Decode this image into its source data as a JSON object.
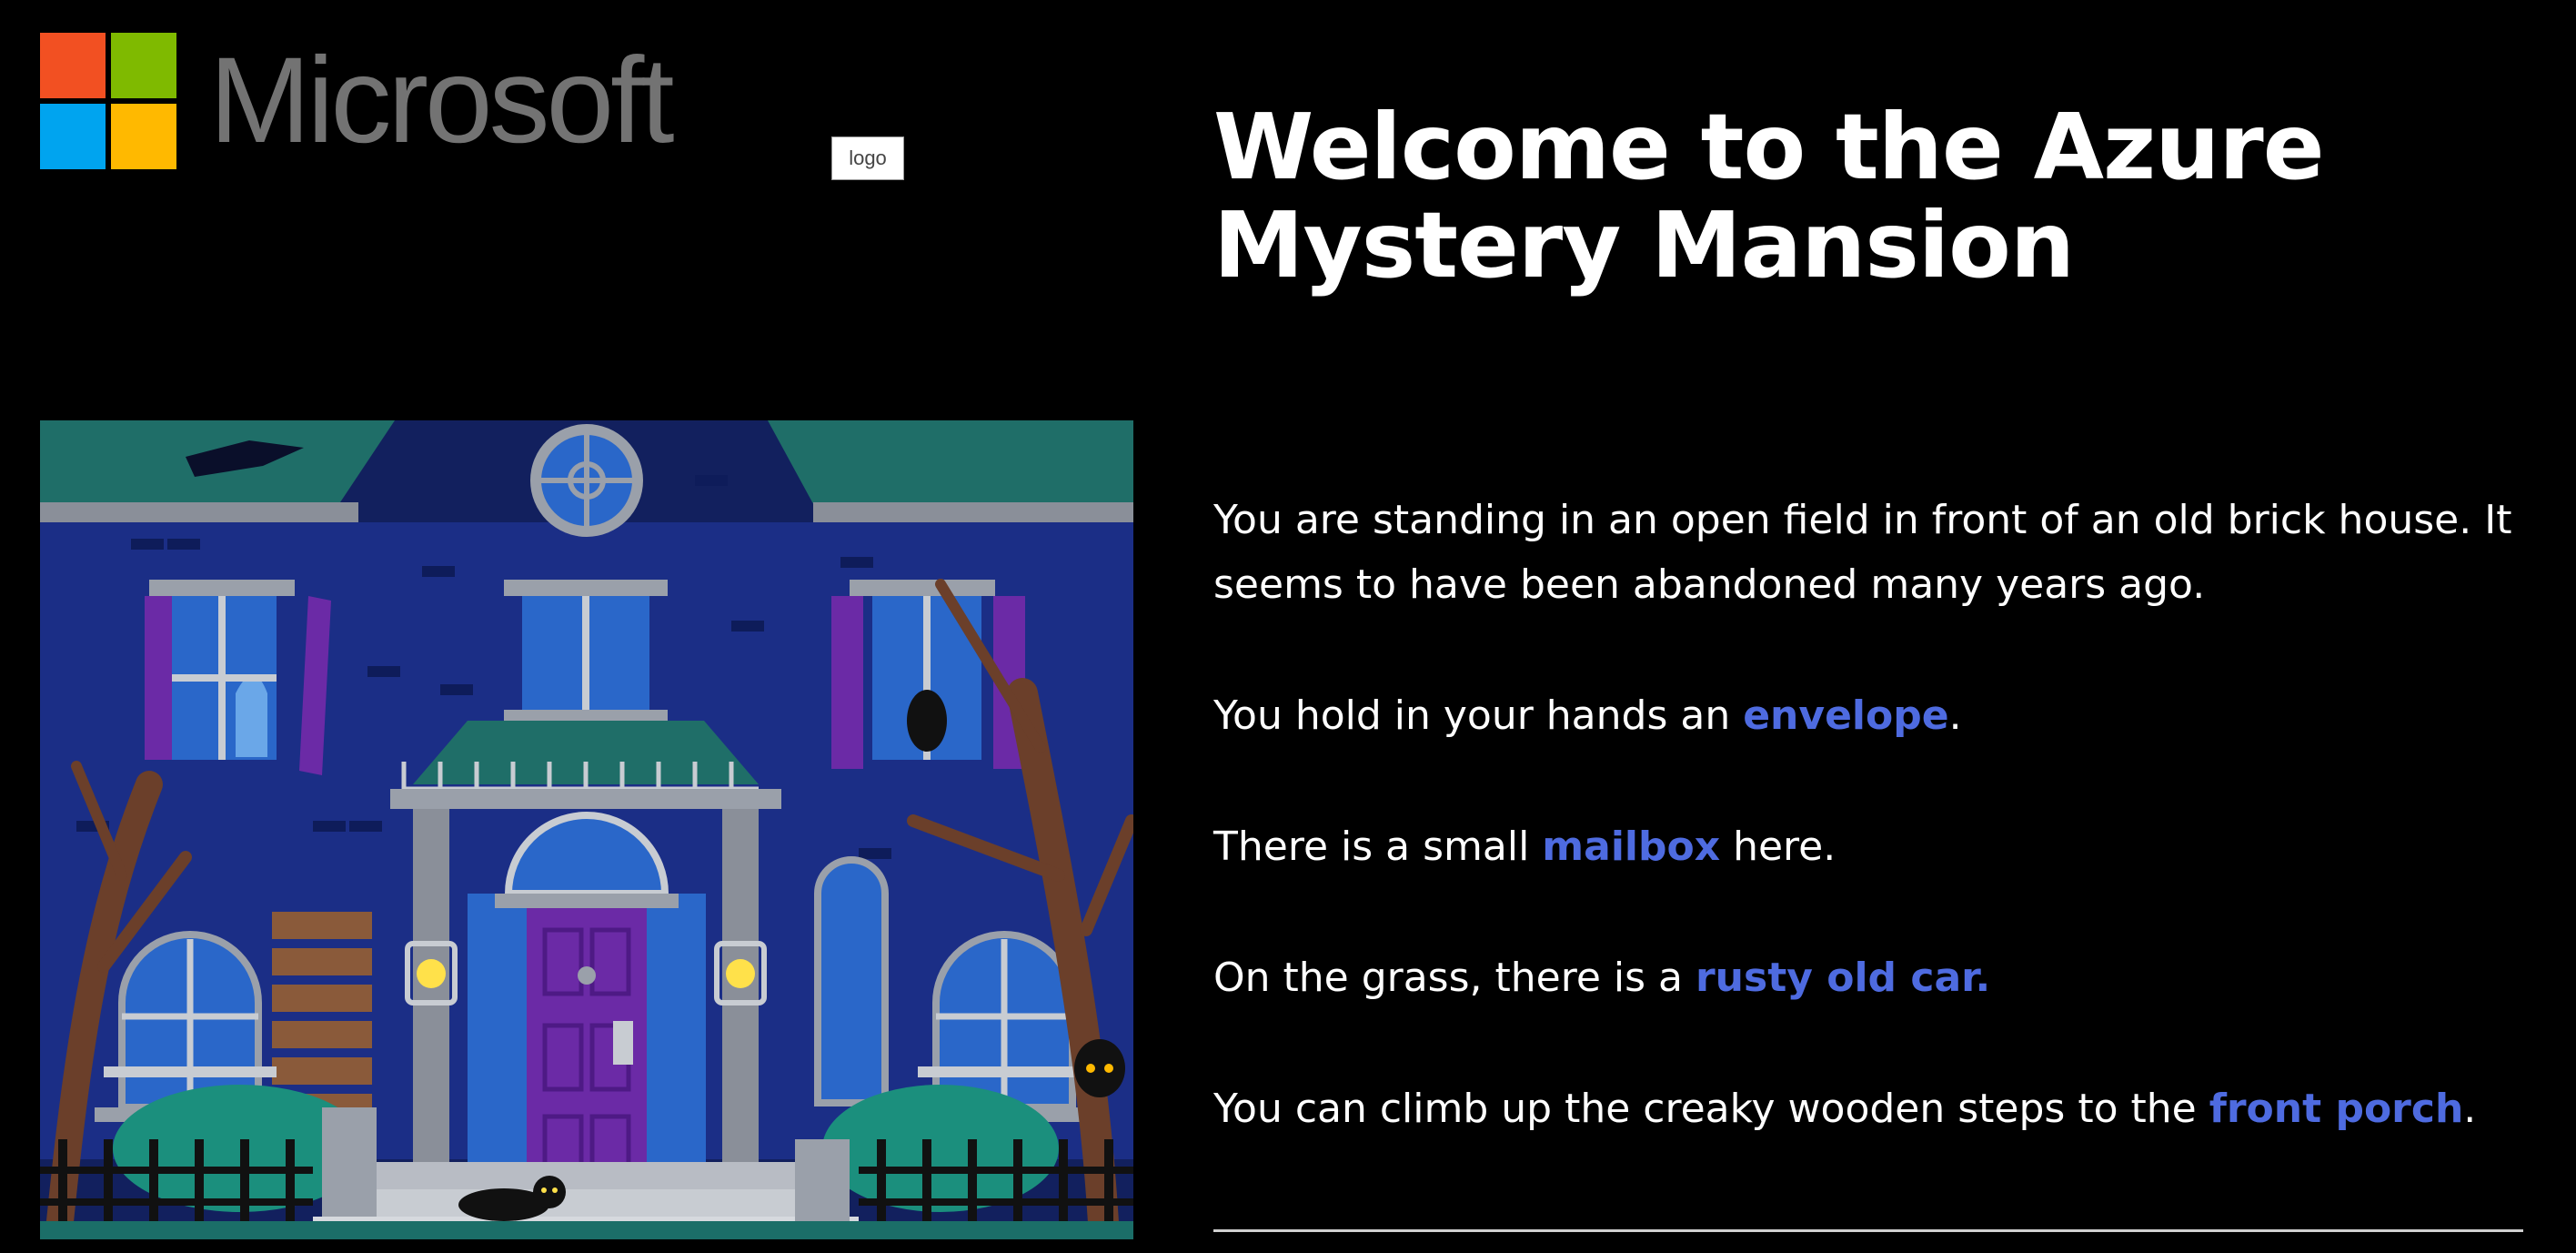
{
  "header": {
    "brand": "Microsoft",
    "logo_placeholder": "logo",
    "brand_colors": {
      "red": "#f25022",
      "green": "#7fba00",
      "blue": "#00a4ef",
      "yellow": "#ffb900",
      "wordmark": "#737373"
    }
  },
  "title": {
    "line1": "Welcome to the Azure",
    "line2": "Mystery Mansion"
  },
  "story": {
    "p1": "You are standing in an open field in front of an old brick house. It seems to have been abandoned many years ago.",
    "p2_pre": "You hold in your hands an ",
    "p2_link": "envelope",
    "p2_post": ".",
    "p3_pre": "There is a small ",
    "p3_link": "mailbox",
    "p3_post": " here.",
    "p4_pre": "On the grass, there is a ",
    "p4_link": "rusty old car.",
    "p5_pre": "You can climb up the creaky wooden steps to the ",
    "p5_link": "front porch",
    "p5_post": "."
  },
  "colors": {
    "background": "#000000",
    "text": "#ffffff",
    "link": "#4e6be0",
    "divider": "#cfcfcf"
  }
}
